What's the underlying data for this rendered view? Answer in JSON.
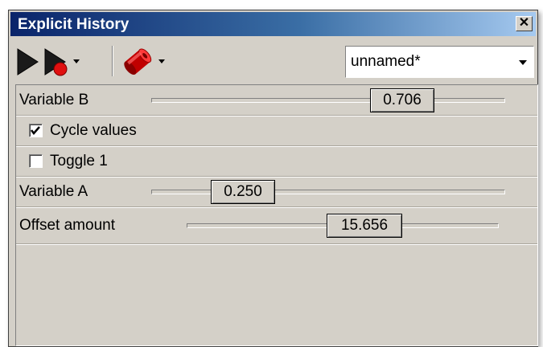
{
  "window": {
    "title": "Explicit History",
    "close_label": "×"
  },
  "toolbar": {
    "play_icon": "play-icon",
    "record_icon": "record-icon",
    "shape_icon": "red-cylinder-icon",
    "preset_value": "unnamed*"
  },
  "controls": {
    "variable_b": {
      "label": "Variable B",
      "value": "0.706"
    },
    "cycle_values": {
      "label": "Cycle values",
      "checked": true
    },
    "toggle_1": {
      "label": "Toggle 1",
      "checked": false
    },
    "variable_a": {
      "label": "Variable A",
      "value": "0.250"
    },
    "offset_amount": {
      "label": "Offset amount",
      "value": "15.656"
    }
  },
  "colors": {
    "title_gradient_start": "#0a246a",
    "title_gradient_end": "#a6caf0",
    "panel_bg": "#d4d0c8",
    "record_red": "#e01010"
  }
}
